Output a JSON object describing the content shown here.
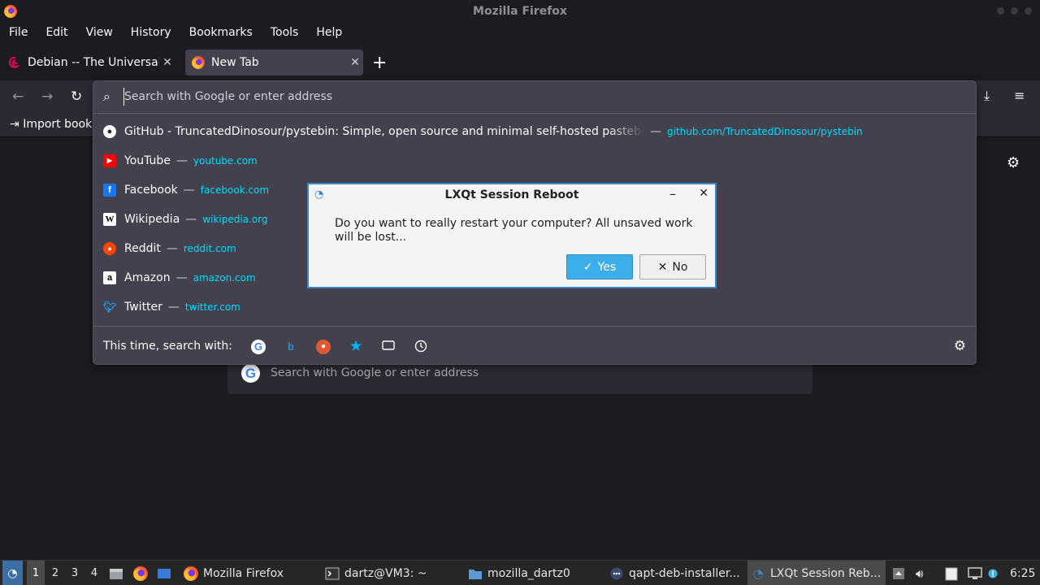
{
  "window": {
    "title": "Mozilla Firefox"
  },
  "menubar": [
    "File",
    "Edit",
    "View",
    "History",
    "Bookmarks",
    "Tools",
    "Help"
  ],
  "tabs": [
    {
      "label": "Debian -- The Universal Operating System",
      "icon": "debian-icon"
    },
    {
      "label": "New Tab",
      "icon": "firefox-icon"
    }
  ],
  "bookmarks_bar": {
    "import_label": "Import book"
  },
  "urlbar": {
    "placeholder": "Search with Google or enter address",
    "results": [
      {
        "title": "GitHub - TruncatedDinosour/pystebin: Simple, open source and minimal self-hosted pastebin",
        "url": "github.com/TruncatedDinosour/pystebin",
        "icon": "github-icon"
      },
      {
        "title": "YouTube",
        "url": "youtube.com",
        "icon": "youtube-icon"
      },
      {
        "title": "Facebook",
        "url": "facebook.com",
        "icon": "facebook-icon"
      },
      {
        "title": "Wikipedia",
        "url": "wikipedia.org",
        "icon": "wikipedia-icon"
      },
      {
        "title": "Reddit",
        "url": "reddit.com",
        "icon": "reddit-icon"
      },
      {
        "title": "Amazon",
        "url": "amazon.com",
        "icon": "amazon-icon"
      },
      {
        "title": "Twitter",
        "url": "twitter.com",
        "icon": "twitter-icon"
      }
    ],
    "separator": "—",
    "footer_label": "This time, search with:"
  },
  "ntp": {
    "search_placeholder": "Search with Google or enter address"
  },
  "dialog": {
    "title": "LXQt Session Reboot",
    "message": "Do you want to really restart your computer? All unsaved work will be lost...",
    "yes_label": "Yes",
    "no_label": "No"
  },
  "taskbar": {
    "workspaces": [
      "1",
      "2",
      "3",
      "4"
    ],
    "tasks": [
      {
        "label": "Mozilla Firefox",
        "icon": "firefox-icon"
      },
      {
        "label": "dartz@VM3: ~",
        "icon": "terminal-icon"
      },
      {
        "label": "mozilla_dartz0",
        "icon": "folder-icon"
      },
      {
        "label": "qapt-deb-installer...",
        "icon": "qapt-icon"
      },
      {
        "label": "LXQt Session Reb...",
        "icon": "lxqt-icon"
      }
    ],
    "clock": "6:25"
  },
  "colors": {
    "accent": "#3daee9",
    "url_text": "#00ddff",
    "dialog_border": "#3b86c6"
  }
}
